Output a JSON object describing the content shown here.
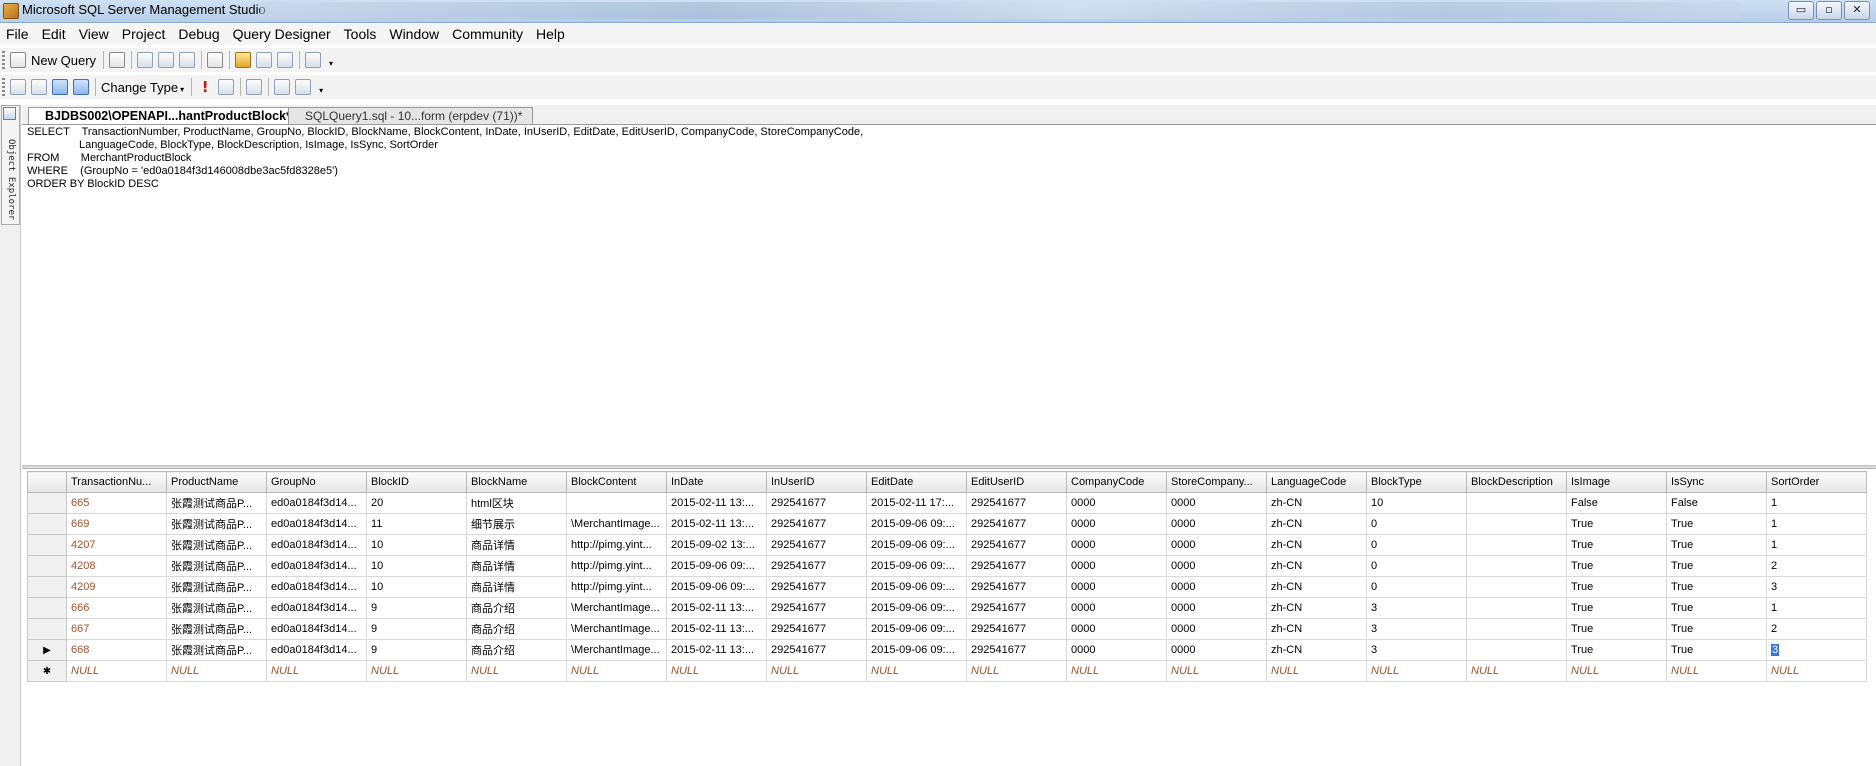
{
  "window": {
    "title": "Microsoft SQL Server Management Studio",
    "minimize": "▭",
    "maximize": "▫",
    "close": "✕"
  },
  "menu": [
    "File",
    "Edit",
    "View",
    "Project",
    "Debug",
    "Query Designer",
    "Tools",
    "Window",
    "Community",
    "Help"
  ],
  "toolbar1": {
    "new_query": "New Query"
  },
  "toolbar2": {
    "change_type": "Change Type",
    "change_type_arrow": "▾"
  },
  "object_explorer": {
    "label": "Object Explorer"
  },
  "tabs": [
    {
      "label": "BJDBS002\\OPENAPI...hantProductBlock*"
    },
    {
      "label": "SQLQuery1.sql - 10...form (erpdev (71))*"
    }
  ],
  "sql_text": "SELECT    TransactionNumber, ProductName, GroupNo, BlockID, BlockName, BlockContent, InDate, InUserID, EditDate, EditUserID, CompanyCode, StoreCompanyCode,\n                 LanguageCode, BlockType, BlockDescription, IsImage, IsSync, SortOrder\nFROM       MerchantProductBlock\nWHERE    (GroupNo = 'ed0a0184f3d146008dbe3ac5fd8328e5')\nORDER BY BlockID DESC",
  "grid": {
    "columns": [
      "TransactionNu...",
      "ProductName",
      "GroupNo",
      "BlockID",
      "BlockName",
      "BlockContent",
      "InDate",
      "InUserID",
      "EditDate",
      "EditUserID",
      "CompanyCode",
      "StoreCompany...",
      "LanguageCode",
      "BlockType",
      "BlockDescription",
      "IsImage",
      "IsSync",
      "SortOrder"
    ],
    "rows": [
      {
        "marker": "",
        "cells": [
          "665",
          "张霞测试商品P...",
          "ed0a0184f3d14...",
          "20",
          "html区块",
          "",
          "2015-02-11 13:...",
          "292541677",
          "2015-02-11 17:...",
          "292541677",
          "0000",
          "0000",
          "zh-CN",
          "10",
          "",
          "False",
          "False",
          "1"
        ]
      },
      {
        "marker": "",
        "cells": [
          "669",
          "张霞测试商品P...",
          "ed0a0184f3d14...",
          "11",
          "细节展示",
          "\\MerchantImage...",
          "2015-02-11 13:...",
          "292541677",
          "2015-09-06 09:...",
          "292541677",
          "0000",
          "0000",
          "zh-CN",
          "0",
          "",
          "True",
          "True",
          "1"
        ]
      },
      {
        "marker": "",
        "cells": [
          "4207",
          "张霞测试商品P...",
          "ed0a0184f3d14...",
          "10",
          "商品详情",
          "http://pimg.yint...",
          "2015-09-02 13:...",
          "292541677",
          "2015-09-06 09:...",
          "292541677",
          "0000",
          "0000",
          "zh-CN",
          "0",
          "",
          "True",
          "True",
          "1"
        ]
      },
      {
        "marker": "",
        "cells": [
          "4208",
          "张霞测试商品P...",
          "ed0a0184f3d14...",
          "10",
          "商品详情",
          "http://pimg.yint...",
          "2015-09-06 09:...",
          "292541677",
          "2015-09-06 09:...",
          "292541677",
          "0000",
          "0000",
          "zh-CN",
          "0",
          "",
          "True",
          "True",
          "2"
        ]
      },
      {
        "marker": "",
        "cells": [
          "4209",
          "张霞测试商品P...",
          "ed0a0184f3d14...",
          "10",
          "商品详情",
          "http://pimg.yint...",
          "2015-09-06 09:...",
          "292541677",
          "2015-09-06 09:...",
          "292541677",
          "0000",
          "0000",
          "zh-CN",
          "0",
          "",
          "True",
          "True",
          "3"
        ]
      },
      {
        "marker": "",
        "cells": [
          "666",
          "张霞测试商品P...",
          "ed0a0184f3d14...",
          "9",
          "商品介绍",
          "\\MerchantImage...",
          "2015-02-11 13:...",
          "292541677",
          "2015-09-06 09:...",
          "292541677",
          "0000",
          "0000",
          "zh-CN",
          "3",
          "",
          "True",
          "True",
          "1"
        ]
      },
      {
        "marker": "",
        "cells": [
          "667",
          "张霞测试商品P...",
          "ed0a0184f3d14...",
          "9",
          "商品介绍",
          "\\MerchantImage...",
          "2015-02-11 13:...",
          "292541677",
          "2015-09-06 09:...",
          "292541677",
          "0000",
          "0000",
          "zh-CN",
          "3",
          "",
          "True",
          "True",
          "2"
        ]
      },
      {
        "marker": "▶",
        "cells": [
          "668",
          "张霞测试商品P...",
          "ed0a0184f3d14...",
          "9",
          "商品介绍",
          "\\MerchantImage...",
          "2015-02-11 13:...",
          "292541677",
          "2015-09-06 09:...",
          "292541677",
          "0000",
          "0000",
          "zh-CN",
          "3",
          "",
          "True",
          "True",
          "3"
        ]
      },
      {
        "marker": "✱",
        "cells": [
          "NULL",
          "NULL",
          "NULL",
          "NULL",
          "NULL",
          "NULL",
          "NULL",
          "NULL",
          "NULL",
          "NULL",
          "NULL",
          "NULL",
          "NULL",
          "NULL",
          "NULL",
          "NULL",
          "NULL",
          "NULL"
        ]
      }
    ]
  }
}
